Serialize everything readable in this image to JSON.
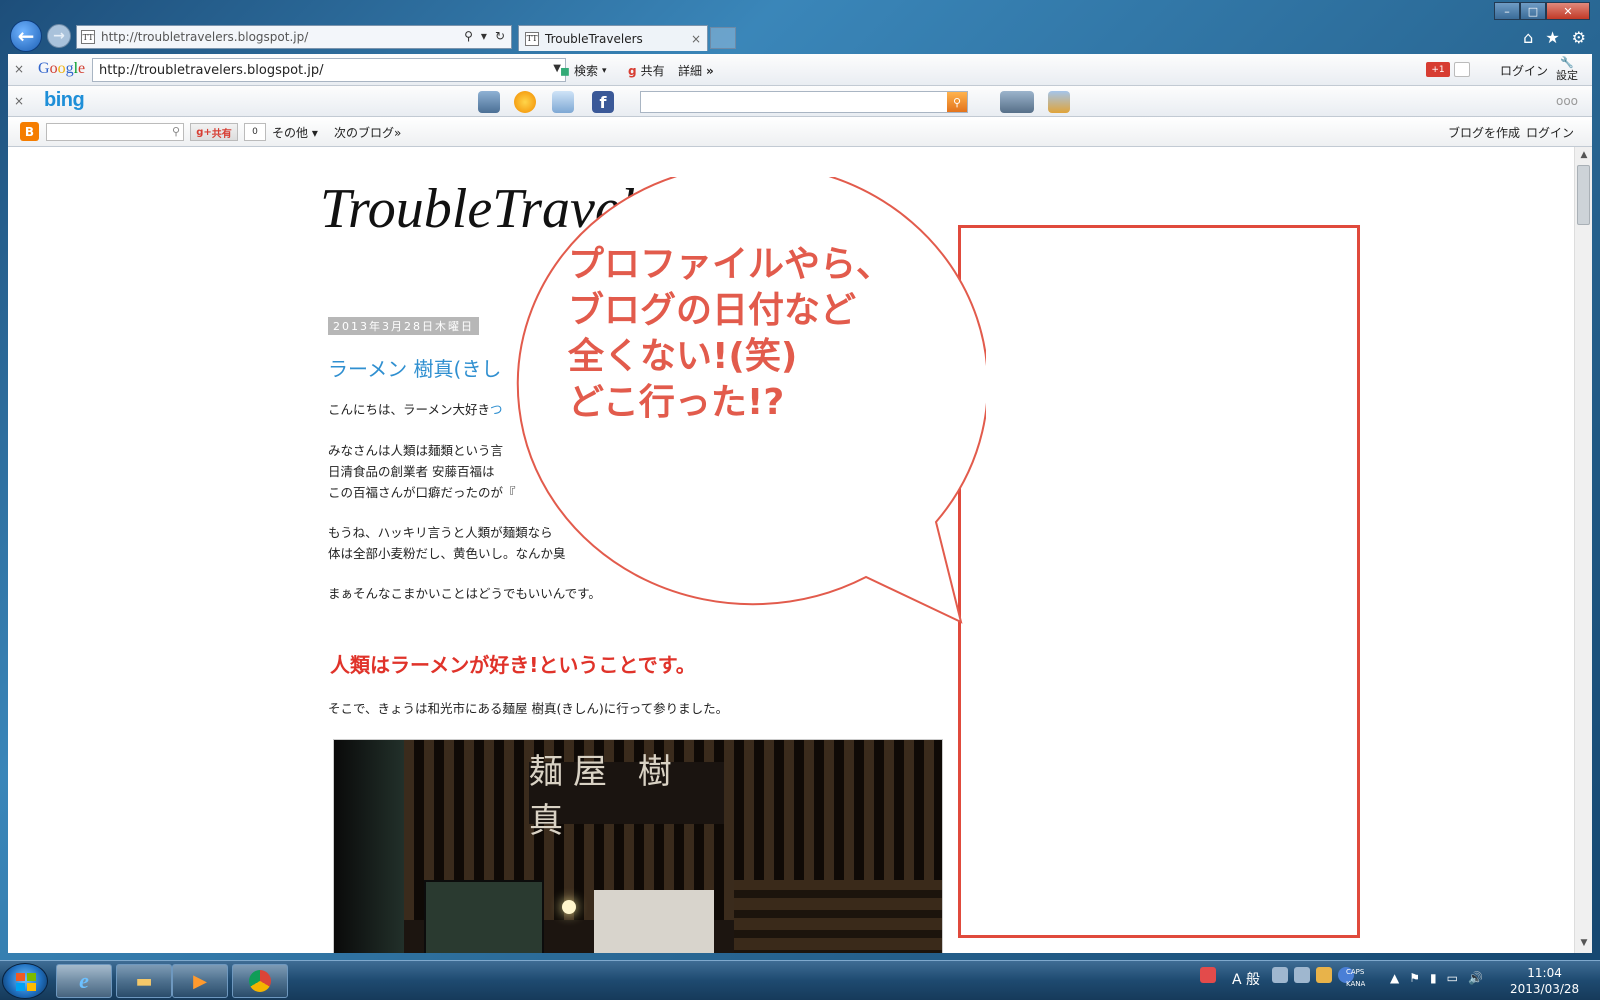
{
  "browser": {
    "address_url": "http://troubletravelers.blogspot.jp/",
    "tab_title": "TroubleTravelers",
    "favicon_text": "TT",
    "tab_close": "×"
  },
  "google_toolbar": {
    "close": "×",
    "logo": "Google",
    "url_value": "http://troubletravelers.blogspot.jp/",
    "search_label": "検索",
    "share_label": "共有",
    "more_label": "詳細",
    "more_arrow": "»",
    "gplus_label": "+1",
    "login_label": "ログイン",
    "settings_label": "設定"
  },
  "bing_toolbar": {
    "close": "×",
    "logo": "bing",
    "search_value": "",
    "more": "ooo"
  },
  "blogger_navbar": {
    "logo": "B",
    "search_value": "",
    "share_label": "共有",
    "share_count": "0",
    "other_label": "その他 ▾",
    "next_blog_label": "次のブログ»",
    "create_blog_label": "ブログを作成",
    "login_label": "ログイン"
  },
  "post": {
    "blog_title": "TroubleTravel",
    "date_header": "2013年3月28日木曜日",
    "title": "ラーメン 樹真(きし",
    "p1_text": "こんにちは、ラーメン大好き",
    "p1_link": "つ",
    "p2_line1": "みなさんは人類は麺類という言",
    "p2_line2": "日清食品の創業者 安藤百福は",
    "p2_line3": "この百福さんが口癖だったのが『",
    "p3_line1": "もうね、ハッキリ言うと人類が麺類なら",
    "p3_line2": "体は全部小麦粉だし、黄色いし。なんか臭",
    "p4": "まぁそんなこまかいことはどうでもいいんです。",
    "red_heading": "人類はラーメンが好き!ということです。",
    "p5": "そこで、きょうは和光市にある麺屋 樹真(きしん)に行って参りました。",
    "photo_sign": "麺屋 樹真"
  },
  "annotation": {
    "bubble_text": "プロファイルやら、\nブログの日付など\n全くない!(笑)\nどこ行った!?",
    "color": "#e25b4c"
  },
  "taskbar": {
    "ime_label": "A 般",
    "caps": "CAPS",
    "kana": "KANA",
    "time": "11:04",
    "date": "2013/03/28"
  }
}
